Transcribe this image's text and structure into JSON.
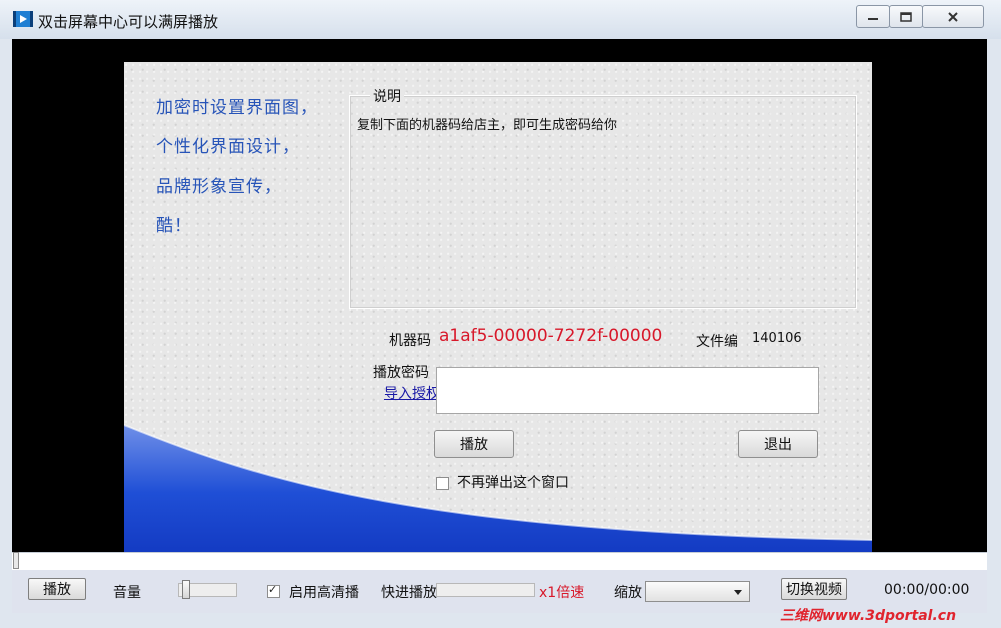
{
  "window": {
    "title": "双击屏幕中心可以满屏播放",
    "icons": {
      "app": "video-player-icon",
      "minimize": "minimize-icon",
      "maximize": "maximize-icon",
      "close": "close-icon"
    }
  },
  "panel": {
    "slogans": [
      "加密时设置界面图，",
      "个性化界面设计，",
      "品牌形象宣传，",
      "酷！"
    ],
    "group_title": "说明",
    "instructions": "复制下面的机器码给店主，即可生成密码给你",
    "machine_code_label": "机器码",
    "machine_code_value": "a1af5-00000-7272f-00000",
    "file_no_label": "文件编",
    "file_no_value": "140106",
    "password_label": "播放密码",
    "password_value": "",
    "import_link": "导入授权",
    "play_button": "播放",
    "exit_button": "退出",
    "no_popup_label": "不再弹出这个窗口",
    "no_popup_checked": false
  },
  "controls": {
    "play_button": "播放",
    "volume_label": "音量",
    "hd_label": "启用高清播",
    "hd_checked": true,
    "ff_label": "快进播放",
    "speed_label": "x1倍速",
    "zoom_label": "缩放",
    "zoom_value": "",
    "switch_button": "切换视频",
    "time": "00:00/00:00"
  },
  "watermark": "三维网www.3dportal.cn",
  "colors": {
    "accent_red": "#d8182a",
    "slogan_blue": "#2754b8",
    "wave_blue": "#1f4fd6",
    "video_bg": "#000000"
  }
}
